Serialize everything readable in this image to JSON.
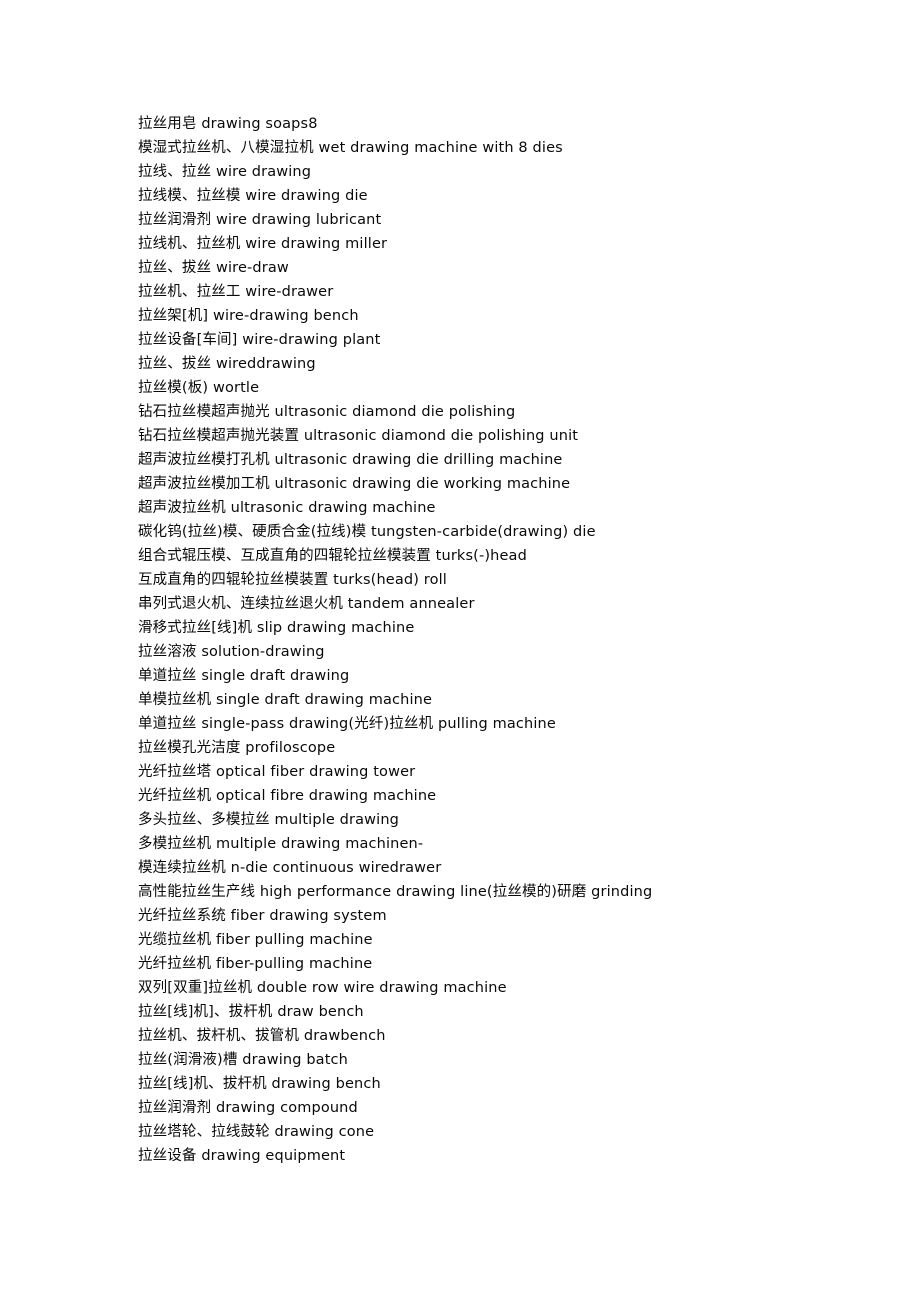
{
  "document": {
    "type": "bilingual-glossary",
    "language_pair": "Chinese-English",
    "topic": "wire drawing terminology",
    "background_color": "#ffffff",
    "text_color": "#0a0a0a",
    "entries": [
      "拉丝用皂  drawing soaps8",
      "模湿式拉丝机、八模湿拉机  wet drawing machine with 8 dies",
      "拉线、拉丝  wire drawing",
      "拉线模、拉丝模  wire drawing die",
      "拉丝润滑剂  wire drawing lubricant",
      "拉线机、拉丝机  wire drawing miller",
      "拉丝、拔丝  wire-draw",
      "拉丝机、拉丝工  wire-drawer",
      "拉丝架[机] wire-drawing bench",
      "拉丝设备[车间] wire-drawing plant",
      "拉丝、拔丝  wireddrawing",
      "拉丝模(板) wortle",
      "钻石拉丝模超声抛光  ultrasonic diamond die polishing",
      "钻石拉丝模超声抛光装置  ultrasonic diamond die polishing unit",
      "超声波拉丝模打孔机  ultrasonic drawing die drilling machine",
      "超声波拉丝模加工机  ultrasonic drawing die working machine",
      "超声波拉丝机  ultrasonic drawing machine",
      "碳化钨(拉丝)模、硬质合金(拉线)模  tungsten-carbide(drawing) die",
      "组合式辊压模、互成直角的四辊轮拉丝模装置  turks(-)head",
      "互成直角的四辊轮拉丝模装置  turks(head) roll",
      "串列式退火机、连续拉丝退火机  tandem annealer",
      "滑移式拉丝[线]机  slip drawing machine",
      "拉丝溶液  solution-drawing",
      "单道拉丝  single draft drawing",
      "单模拉丝机  single draft drawing machine",
      "单道拉丝  single-pass drawing(光纤)拉丝机  pulling machine",
      "拉丝模孔光洁度  profiloscope",
      "光纤拉丝塔  optical fiber drawing tower",
      "光纤拉丝机  optical fibre drawing machine",
      "多头拉丝、多模拉丝  multiple drawing",
      "多模拉丝机  multiple drawing machinen-",
      "模连续拉丝机  n-die continuous wiredrawer",
      "高性能拉丝生产线  high performance drawing line(拉丝模的)研磨  grinding",
      "光纤拉丝系统  fiber drawing system",
      "光缆拉丝机  fiber pulling machine",
      "光纤拉丝机  fiber-pulling machine",
      "双列[双重]拉丝机  double row wire drawing machine",
      "拉丝[线]机]、拔杆机  draw bench",
      "拉丝机、拔杆机、拔管机  drawbench",
      "拉丝(润滑液)槽  drawing batch",
      "拉丝[线]机、拔杆机  drawing bench",
      "拉丝润滑剂  drawing compound",
      "拉丝塔轮、拉线鼓轮  drawing cone",
      "拉丝设备  drawing equipment"
    ]
  }
}
